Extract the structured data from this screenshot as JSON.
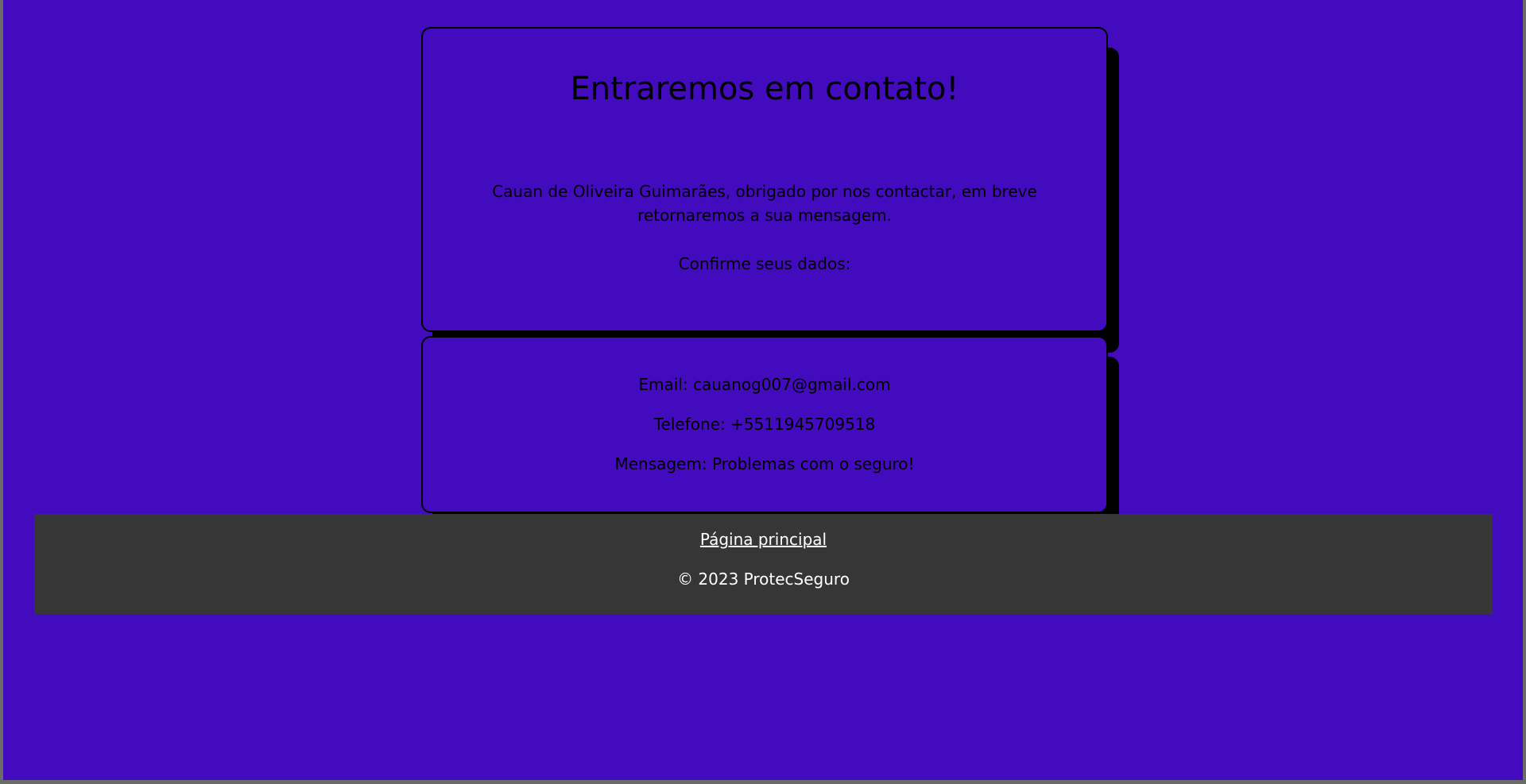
{
  "card": {
    "heading": "Entraremos em contato!",
    "message": "Cauan de Oliveira Guimarães, obrigado por nos contactar, em breve retornaremos a sua mensagem.",
    "confirm": "Confirme seus dados:"
  },
  "details": {
    "email": "Email: cauanog007@gmail.com",
    "phone": "Telefone: +5511945709518",
    "message": "Mensagem: Problemas com o seguro!"
  },
  "footer": {
    "link_label": "Página principal",
    "copyright": "© 2023 ProtecSeguro"
  },
  "colors": {
    "page_background": "#420bbd",
    "card_shadow": "#000000",
    "footer_background": "#363636",
    "footer_text": "#ffffff"
  }
}
